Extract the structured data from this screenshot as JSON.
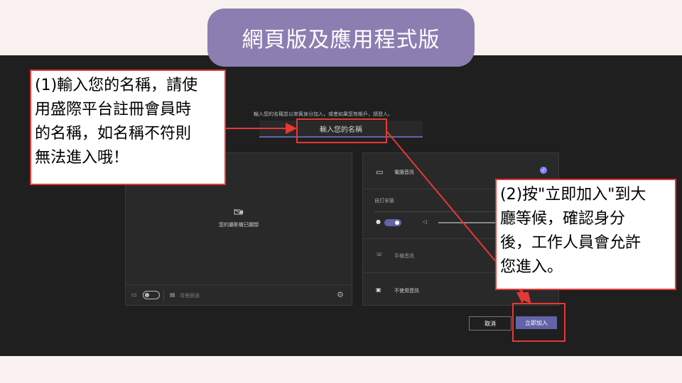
{
  "header": {
    "title": "網頁版及應用程式版"
  },
  "join_form": {
    "prompt": "輸入您的名稱並以來賓身分加入，或者如果您有帳戶，請登入。",
    "name_placeholder": "輸入您的名稱"
  },
  "video_panel": {
    "camera_off_text": "您的攝影機已關閉",
    "background_filters_label": "背景篩選"
  },
  "audio_panel": {
    "computer_audio_label": "電腦音訊",
    "custom_setup_label": "自訂安裝",
    "phone_audio_label": "手機音訊",
    "no_audio_label": "不使用音訊"
  },
  "buttons": {
    "cancel_label": "取消",
    "join_label": "立即加入"
  },
  "callouts": {
    "step1_lines": [
      "(1)輸入您的名稱，請使",
      "用盛際平台註冊會員時",
      "的名稱，如名稱不符則",
      "無法進入哦！"
    ],
    "step2_lines": [
      "(2)按\"立即加入\"到大",
      "廳等候，確認身分",
      "後，工作人員會允許",
      "您進入。"
    ]
  },
  "colors": {
    "accent": "#6264a7",
    "annotation_red": "#e53935",
    "header_pill": "#8c7eb1"
  }
}
